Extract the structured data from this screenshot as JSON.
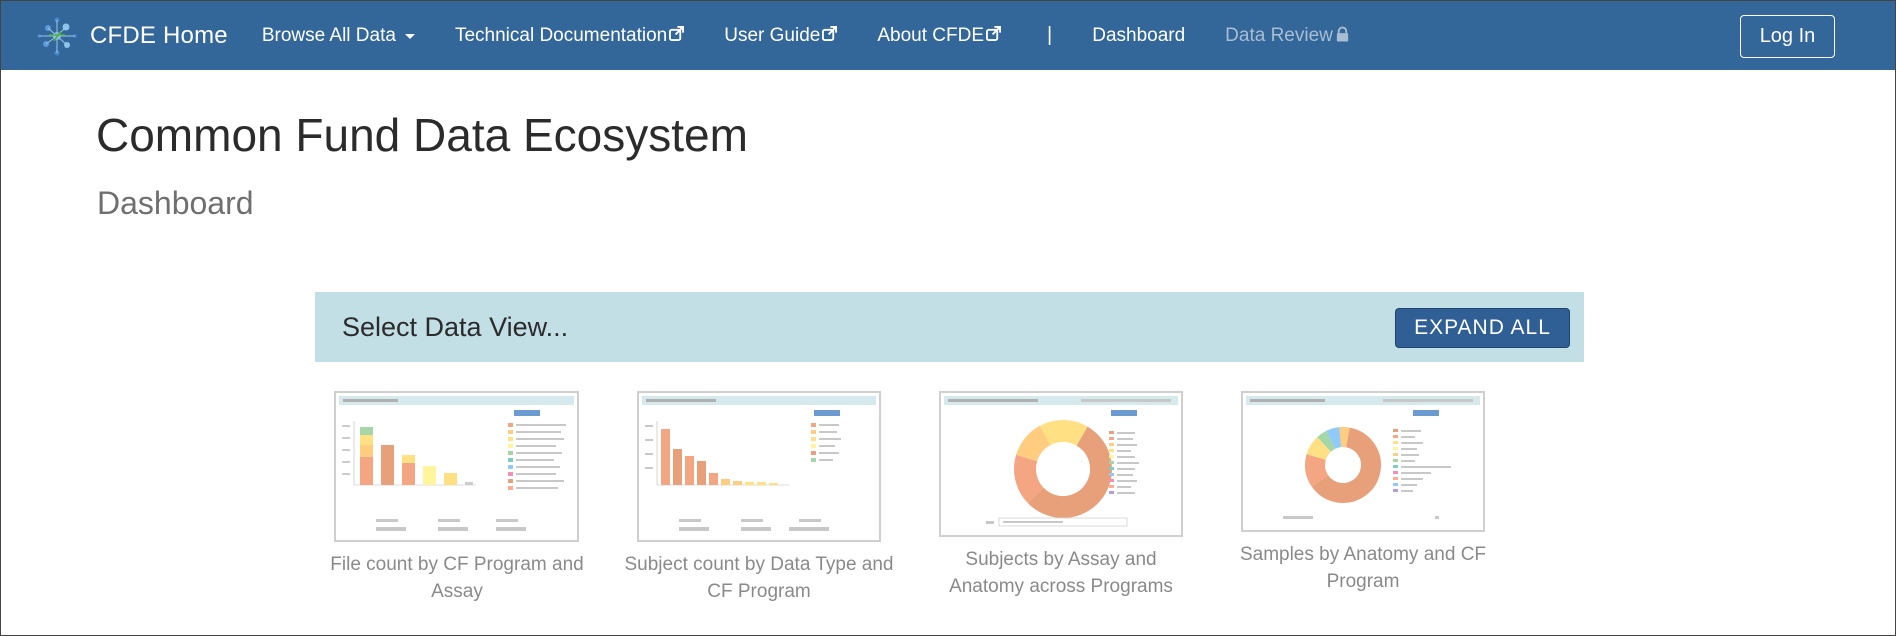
{
  "nav": {
    "brand": "CFDE Home",
    "items": [
      {
        "label": "Browse All Data",
        "icon": "caret-down"
      },
      {
        "label": "Technical Documentation",
        "icon": "external-link-icon"
      },
      {
        "label": "User Guide",
        "icon": "external-link-icon"
      },
      {
        "label": "About CFDE",
        "icon": "external-link-icon"
      }
    ],
    "separator": "|",
    "dashboard": "Dashboard",
    "data_review": "Data Review",
    "login": "Log In"
  },
  "page": {
    "title": "Common Fund Data Ecosystem",
    "subtitle": "Dashboard"
  },
  "data_view": {
    "label": "Select Data View...",
    "expand_all": "EXPAND ALL"
  },
  "cards": [
    {
      "caption": "File count by CF Program and Assay",
      "type": "bar-stacked"
    },
    {
      "caption": "Subject count by Data Type and CF Program",
      "type": "bar"
    },
    {
      "caption": "Subjects by Assay and Anatomy across Programs",
      "type": "donut"
    },
    {
      "caption": "Samples by Anatomy and CF Program",
      "type": "donut"
    }
  ],
  "colors": {
    "navbar": "#336699",
    "accent_bar": "#c2dfe6",
    "button": "#2f5f95"
  }
}
